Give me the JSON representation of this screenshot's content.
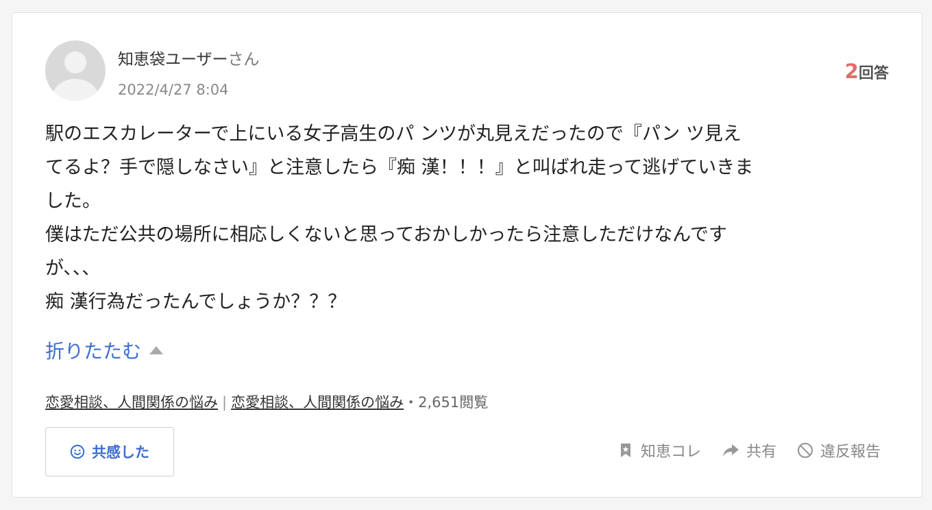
{
  "user": {
    "name": "知恵袋ユーザー",
    "suffix": "さん",
    "date": "2022/4/27 8:04"
  },
  "answers": {
    "count": "2",
    "unit": "回答"
  },
  "question": {
    "lines": [
      "駅のエスカレーターで上にいる女子高生のパ ンツが丸見えだったので『パン ツ見え",
      "てるよ？手で隠しなさい』と注意したら『痴 漢！！！』と叫ばれ走って逃げていきま",
      "した。",
      "僕はただ公共の場所に相応しくないと思っておかしかったら注意しただけなんです",
      "が､､､",
      "痴 漢行為だったんでしょうか？？？"
    ]
  },
  "collapse_label": "折りたたむ",
  "meta": {
    "category1": "恋愛相談、人間関係の悩み",
    "separator": "|",
    "category2": "恋愛相談、人間関係の悩み",
    "views": "・2,651閲覧"
  },
  "empathy": {
    "label": "共感した"
  },
  "actions": {
    "bookmark": "知恵コレ",
    "share": "共有",
    "report": "違反報告"
  },
  "colors": {
    "accent_blue": "#3c6ccf",
    "answer_count_red": "#e66a6a",
    "muted_gray": "#888888"
  }
}
